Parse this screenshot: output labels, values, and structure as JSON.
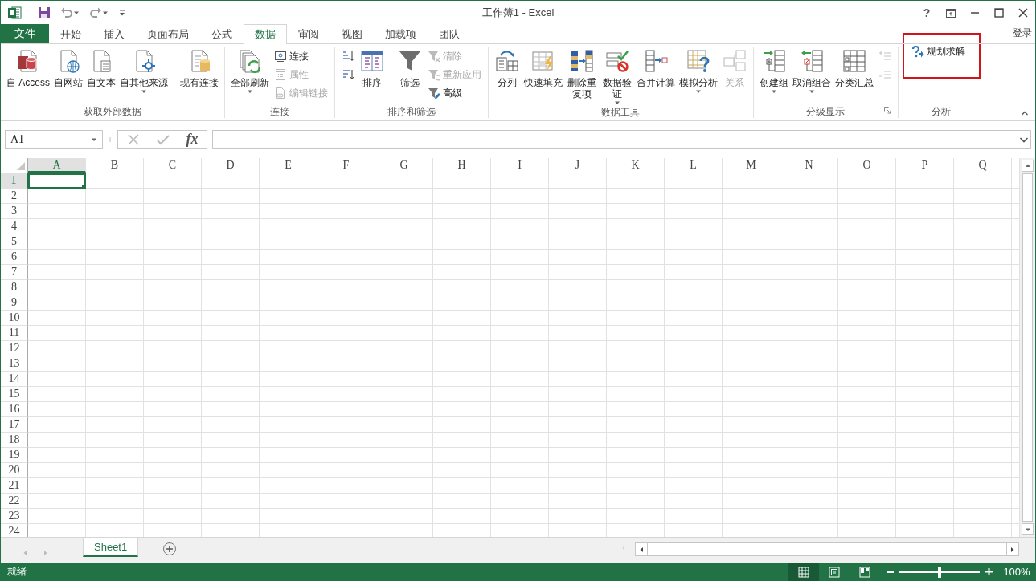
{
  "title_bar": {
    "title": "工作簿1 - Excel",
    "help": "?"
  },
  "tabs": [
    {
      "label": "文件",
      "kind": "file",
      "selected": false
    },
    {
      "label": "开始",
      "kind": "tab",
      "selected": false
    },
    {
      "label": "插入",
      "kind": "tab",
      "selected": false
    },
    {
      "label": "页面布局",
      "kind": "tab",
      "selected": false
    },
    {
      "label": "公式",
      "kind": "tab",
      "selected": false
    },
    {
      "label": "数据",
      "kind": "tab",
      "selected": true
    },
    {
      "label": "审阅",
      "kind": "tab",
      "selected": false
    },
    {
      "label": "视图",
      "kind": "tab",
      "selected": false
    },
    {
      "label": "加载项",
      "kind": "tab",
      "selected": false
    },
    {
      "label": "团队",
      "kind": "tab",
      "selected": false
    }
  ],
  "account": "登录",
  "ribbon": {
    "groups": [
      {
        "label": "获取外部数据",
        "dialog_launcher": false,
        "items": [
          {
            "kind": "large",
            "label": "自 Access",
            "disabled": false,
            "dropdown": false
          },
          {
            "kind": "large",
            "label": "自网站",
            "disabled": false,
            "dropdown": false
          },
          {
            "kind": "large",
            "label": "自文本",
            "disabled": false,
            "dropdown": false
          },
          {
            "kind": "large",
            "label": "自其他来源",
            "disabled": false,
            "dropdown": true
          },
          {
            "kind": "separator"
          },
          {
            "kind": "large",
            "label": "现有连接",
            "disabled": false,
            "dropdown": false
          }
        ]
      },
      {
        "label": "连接",
        "dialog_launcher": false,
        "items": [
          {
            "kind": "large",
            "label": "全部刷新",
            "disabled": false,
            "dropdown": true
          },
          {
            "kind": "stack",
            "items": [
              {
                "kind": "small",
                "label": "连接",
                "disabled": false
              },
              {
                "kind": "small",
                "label": "属性",
                "disabled": true
              },
              {
                "kind": "small",
                "label": "编辑链接",
                "disabled": true
              }
            ]
          }
        ]
      },
      {
        "label": "排序和筛选",
        "dialog_launcher": false,
        "items": [
          {
            "kind": "stack",
            "items": [
              {
                "kind": "icon",
                "disabled": false
              },
              {
                "kind": "icon",
                "disabled": false
              }
            ]
          },
          {
            "kind": "large",
            "label": "排序",
            "disabled": false,
            "dropdown": false
          },
          {
            "kind": "separator"
          },
          {
            "kind": "large",
            "label": "筛选",
            "disabled": false,
            "dropdown": false
          },
          {
            "kind": "stack",
            "items": [
              {
                "kind": "small",
                "label": "清除",
                "disabled": true
              },
              {
                "kind": "small",
                "label": "重新应用",
                "disabled": true
              },
              {
                "kind": "small",
                "label": "高级",
                "disabled": false
              }
            ]
          }
        ]
      },
      {
        "label": "数据工具",
        "dialog_launcher": false,
        "items": [
          {
            "kind": "large",
            "label": "分列",
            "disabled": false,
            "dropdown": false
          },
          {
            "kind": "large",
            "label": "快速填充",
            "disabled": false,
            "dropdown": false
          },
          {
            "kind": "large",
            "label": "删除重复项",
            "disabled": false,
            "dropdown": false
          },
          {
            "kind": "large",
            "label": "数据验证",
            "disabled": false,
            "dropdown": true
          },
          {
            "kind": "large",
            "label": "合并计算",
            "disabled": false,
            "dropdown": false
          },
          {
            "kind": "large",
            "label": "模拟分析",
            "disabled": false,
            "dropdown": true
          },
          {
            "kind": "large",
            "label": "关系",
            "disabled": true,
            "dropdown": false
          }
        ]
      },
      {
        "label": "分级显示",
        "dialog_launcher": true,
        "items": [
          {
            "kind": "large",
            "label": "创建组",
            "disabled": false,
            "dropdown": true
          },
          {
            "kind": "large",
            "label": "取消组合",
            "disabled": false,
            "dropdown": true
          },
          {
            "kind": "large",
            "label": "分类汇总",
            "disabled": false,
            "dropdown": false
          },
          {
            "kind": "stack",
            "items": [
              {
                "kind": "icon",
                "disabled": true
              },
              {
                "kind": "icon",
                "disabled": true
              }
            ]
          }
        ]
      },
      {
        "label": "分析",
        "dialog_launcher": false,
        "items": [
          {
            "kind": "stack",
            "items": [
              {
                "kind": "small",
                "label": "规划求解",
                "disabled": false,
                "highlighted": true
              }
            ]
          }
        ]
      }
    ]
  },
  "formula_bar": {
    "name_box": "A1",
    "fx": "fx"
  },
  "grid": {
    "columns": [
      {
        "label": "A",
        "selected": true
      },
      {
        "label": "B",
        "selected": false
      },
      {
        "label": "C",
        "selected": false
      },
      {
        "label": "D",
        "selected": false
      },
      {
        "label": "E",
        "selected": false
      },
      {
        "label": "F",
        "selected": false
      },
      {
        "label": "G",
        "selected": false
      },
      {
        "label": "H",
        "selected": false
      },
      {
        "label": "I",
        "selected": false
      },
      {
        "label": "J",
        "selected": false
      },
      {
        "label": "K",
        "selected": false
      },
      {
        "label": "L",
        "selected": false
      },
      {
        "label": "M",
        "selected": false
      },
      {
        "label": "N",
        "selected": false
      },
      {
        "label": "O",
        "selected": false
      },
      {
        "label": "P",
        "selected": false
      },
      {
        "label": "Q",
        "selected": false
      }
    ],
    "rows": [
      {
        "label": "1",
        "selected": true
      },
      {
        "label": "2",
        "selected": false
      },
      {
        "label": "3",
        "selected": false
      },
      {
        "label": "4",
        "selected": false
      },
      {
        "label": "5",
        "selected": false
      },
      {
        "label": "6",
        "selected": false
      },
      {
        "label": "7",
        "selected": false
      },
      {
        "label": "8",
        "selected": false
      },
      {
        "label": "9",
        "selected": false
      },
      {
        "label": "10",
        "selected": false
      },
      {
        "label": "11",
        "selected": false
      },
      {
        "label": "12",
        "selected": false
      },
      {
        "label": "13",
        "selected": false
      },
      {
        "label": "14",
        "selected": false
      },
      {
        "label": "15",
        "selected": false
      },
      {
        "label": "16",
        "selected": false
      },
      {
        "label": "17",
        "selected": false
      },
      {
        "label": "18",
        "selected": false
      },
      {
        "label": "19",
        "selected": false
      },
      {
        "label": "20",
        "selected": false
      },
      {
        "label": "21",
        "selected": false
      },
      {
        "label": "22",
        "selected": false
      },
      {
        "label": "23",
        "selected": false
      },
      {
        "label": "24",
        "selected": false
      }
    ]
  },
  "sheets": [
    {
      "label": "Sheet1",
      "selected": true
    }
  ],
  "status_bar": {
    "status": "就绪",
    "views": [
      {
        "selected": true
      },
      {
        "selected": false
      },
      {
        "selected": false
      }
    ],
    "zoom": {
      "level": 0.5,
      "reading": "100%"
    }
  }
}
